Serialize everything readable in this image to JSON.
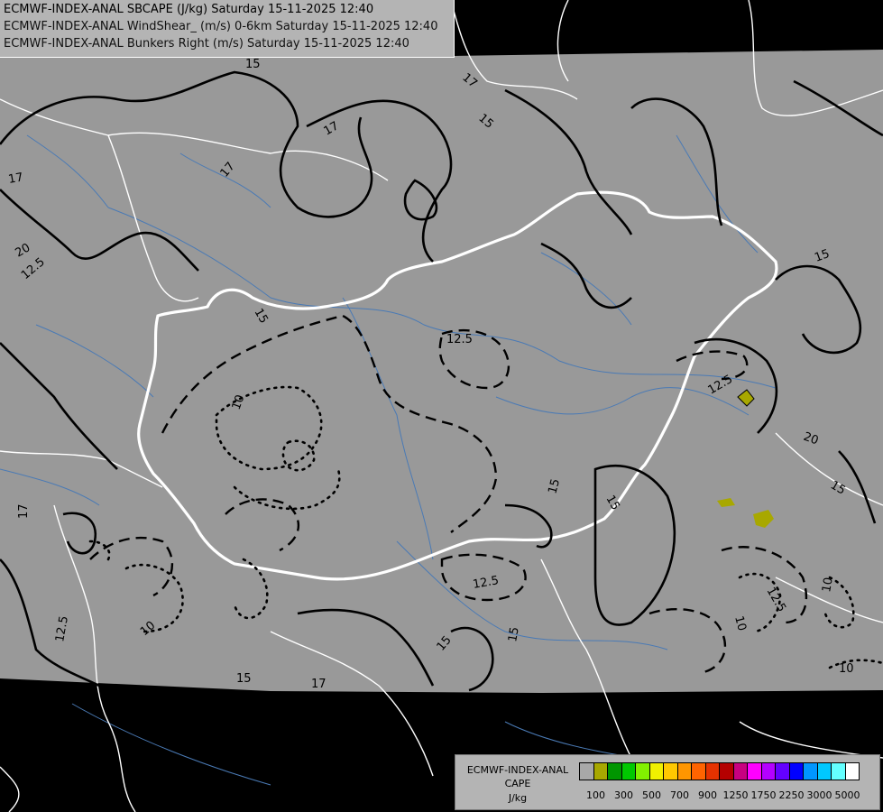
{
  "header": {
    "line1": "ECMWF-INDEX-ANAL SBCAPE (J/kg) Saturday 15-11-2025 12:40",
    "line2": "ECMWF-INDEX-ANAL WindShear_ (m/s) 0-6km Saturday 15-11-2025 12:40",
    "line3": "ECMWF-INDEX-ANAL Bunkers Right (m/s) Saturday 15-11-2025 12:40"
  },
  "legend": {
    "title1": "ECMWF-INDEX-ANAL",
    "title2": "CAPE",
    "title3": "J/kg",
    "colors": [
      "#a8a8a8",
      "#a8a800",
      "#009600",
      "#00c800",
      "#82f000",
      "#f0f000",
      "#ffc800",
      "#ff9600",
      "#ff6400",
      "#e63200",
      "#b40000",
      "#c80080",
      "#ff00ff",
      "#b400ff",
      "#6400ff",
      "#0000ff",
      "#0096ff",
      "#00c8ff",
      "#64ffff",
      "#ffffff"
    ],
    "tick_labels": [
      "100",
      "300",
      "500",
      "700",
      "900",
      "1250",
      "1750",
      "2250",
      "3000",
      "5000"
    ]
  },
  "map": {
    "background": "#999999",
    "outside": "#000000",
    "contour_labels": {
      "solid": [
        "15",
        "17",
        "17",
        "17",
        "15",
        "15",
        "20",
        "17",
        "15",
        "15",
        "15",
        "15",
        "20",
        "17",
        "15",
        "15",
        "17",
        "15"
      ],
      "dashed": [
        "12.5",
        "12.5",
        "12.5",
        "12.5",
        "12.5",
        "12.5"
      ],
      "dotted": [
        "10",
        "10",
        "10",
        "10",
        "10"
      ]
    }
  }
}
